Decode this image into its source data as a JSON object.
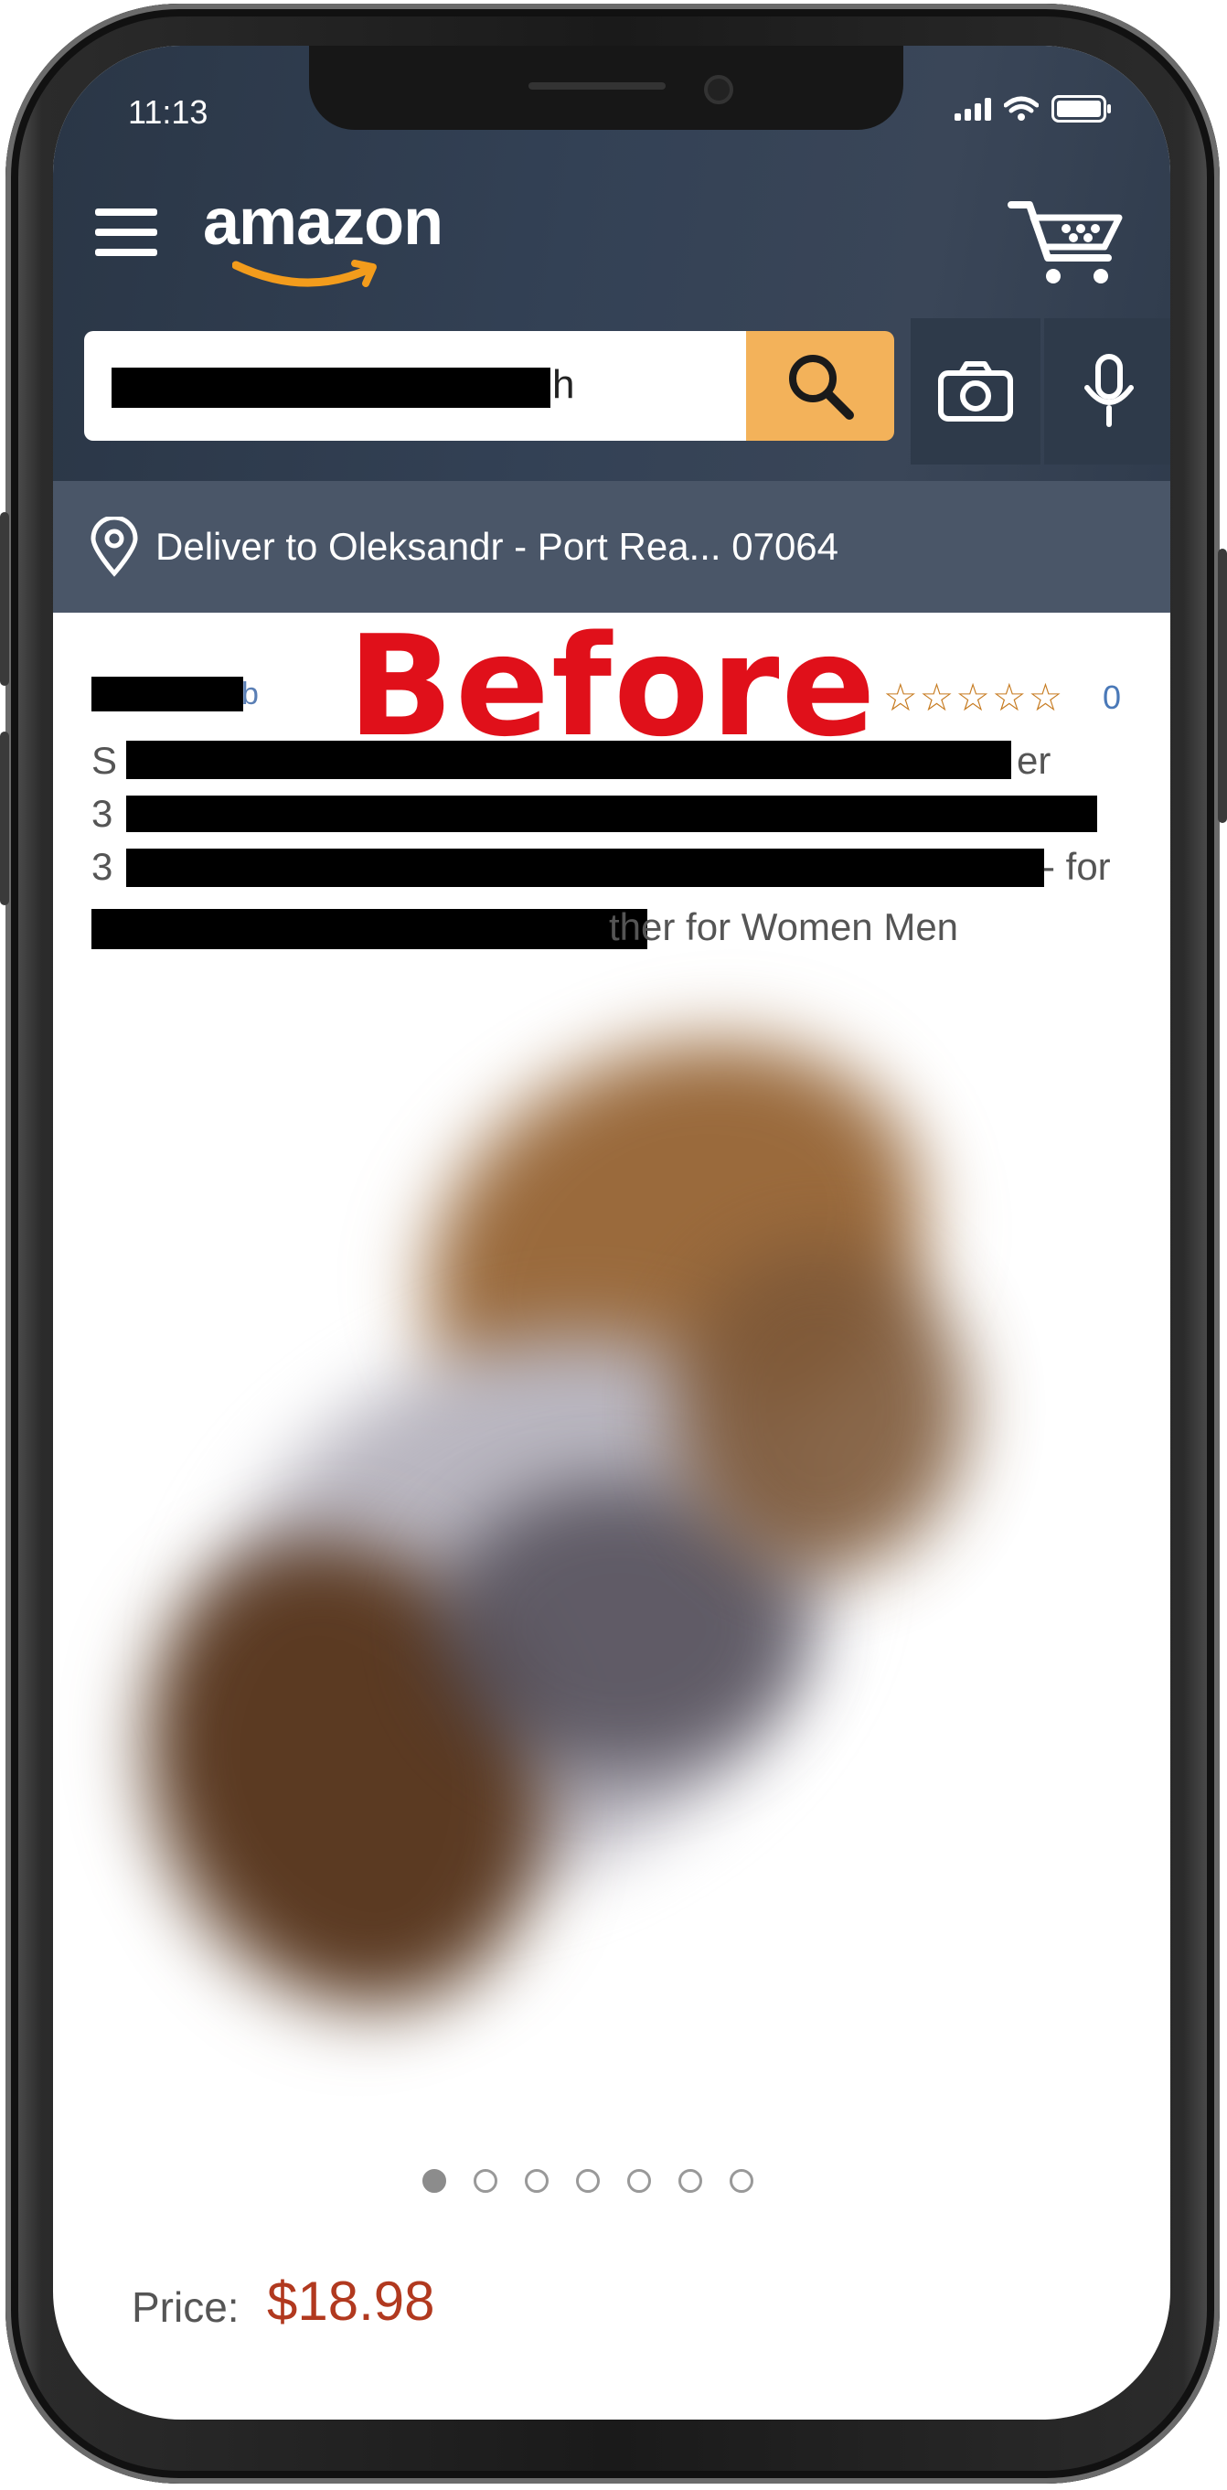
{
  "status_bar": {
    "time": "11:13"
  },
  "header": {
    "logo_text": "amazon",
    "search": {
      "value_visible_tail": "h"
    },
    "colors": {
      "header_bg": "#334155",
      "search_button": "#f3b25a",
      "deliver_bar": "#4a5668"
    }
  },
  "deliver": {
    "text": "Deliver to Oleksandr - Port Rea... 07064"
  },
  "overlay": {
    "label": "Before",
    "color": "#e0101a"
  },
  "product": {
    "brand_tail": "b",
    "rating_stars": "☆☆☆☆☆",
    "rating_count": "0",
    "title_lines": [
      {
        "lead": "S",
        "tail": "er"
      },
      {
        "lead": "3",
        "tail": ""
      },
      {
        "lead": "3",
        "tail": "- for"
      },
      {
        "lead": "",
        "tail": "ther for Women Men"
      }
    ],
    "carousel": {
      "count": 7,
      "active_index": 0
    },
    "price_label": "Price:",
    "price_value": "$18.98",
    "price_color": "#b1391f"
  },
  "icons": [
    "menu-icon",
    "cart-icon",
    "search-icon",
    "camera-icon",
    "microphone-icon",
    "location-pin-icon",
    "signal-icon",
    "wifi-icon",
    "battery-icon"
  ]
}
